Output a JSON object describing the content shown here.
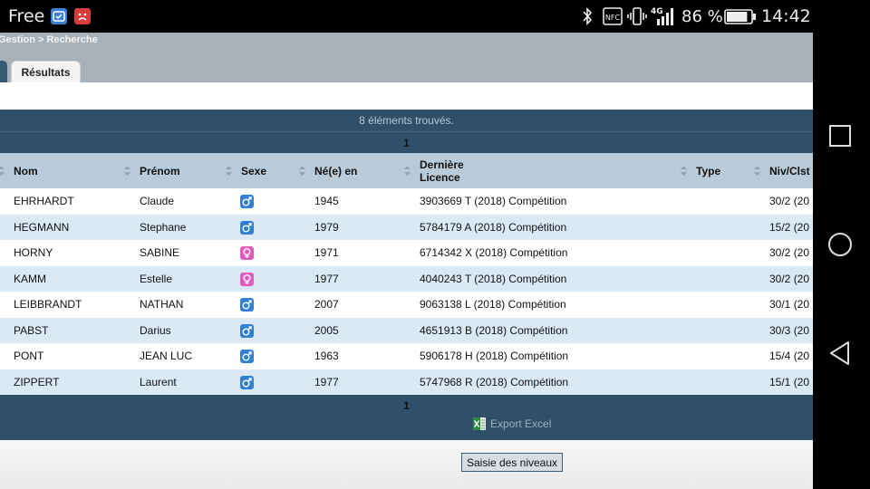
{
  "status_bar": {
    "carrier": "Free",
    "notification_icons": [
      "app-icon",
      "sad-face-icon"
    ],
    "system_icons": [
      "bluetooth-icon",
      "nfc-icon",
      "vibrate-icon",
      "4g-signal-icon",
      "battery-icon"
    ],
    "battery_text": "86 %",
    "battery_level": 0.86,
    "time": "14:42"
  },
  "nav_bar": {
    "buttons": [
      "recents",
      "home",
      "back"
    ]
  },
  "header": {
    "breadcrumb": "Gestion > Recherche",
    "tabs": [
      {
        "label": "",
        "active": false
      },
      {
        "label": "Résultats",
        "active": true
      }
    ]
  },
  "results": {
    "count_text": "8 éléments trouvés.",
    "page_top": "1",
    "page_bottom": "1",
    "export_label": "Export Excel",
    "columns": {
      "nom": "Nom",
      "prenom": "Prénom",
      "sexe": "Sexe",
      "ne": "Né(e) en",
      "licence_line1": "Dernière",
      "licence_line2": "Licence",
      "type": "Type",
      "niv": "Niv/Clst"
    },
    "rows": [
      {
        "nom": "EHRHARDT",
        "prenom": "Claude",
        "sexe": "M",
        "ne": "1945",
        "licence": "3903669 T (2018) Compétition",
        "type": "",
        "niv": "30/2 (20"
      },
      {
        "nom": "HEGMANN",
        "prenom": "Stephane",
        "sexe": "M",
        "ne": "1979",
        "licence": "5784179 A (2018) Compétition",
        "type": "",
        "niv": "15/2 (20"
      },
      {
        "nom": "HORNY",
        "prenom": "SABINE",
        "sexe": "F",
        "ne": "1971",
        "licence": "6714342 X (2018) Compétition",
        "type": "",
        "niv": "30/2 (20"
      },
      {
        "nom": "KAMM",
        "prenom": "Estelle",
        "sexe": "F",
        "ne": "1977",
        "licence": "4040243 T (2018) Compétition",
        "type": "",
        "niv": "30/2 (20"
      },
      {
        "nom": "LEIBBRANDT",
        "prenom": "NATHAN",
        "sexe": "M",
        "ne": "2007",
        "licence": "9063138 L (2018) Compétition",
        "type": "",
        "niv": "30/1 (20"
      },
      {
        "nom": "PABST",
        "prenom": "Darius",
        "sexe": "M",
        "ne": "2005",
        "licence": "4651913 B (2018) Compétition",
        "type": "",
        "niv": "30/3 (20"
      },
      {
        "nom": "PONT",
        "prenom": "JEAN LUC",
        "sexe": "M",
        "ne": "1963",
        "licence": "5906178 H (2018) Compétition",
        "type": "",
        "niv": "15/4 (20"
      },
      {
        "nom": "ZIPPERT",
        "prenom": "Laurent",
        "sexe": "M",
        "ne": "1977",
        "licence": "5747968 R (2018) Compétition",
        "type": "",
        "niv": "15/1 (20"
      }
    ]
  },
  "footer": {
    "button_label": "Saisie des niveaux"
  },
  "colors": {
    "dark_band": "#2f5068",
    "header_row": "#b9cbd8",
    "row_alt": "#dbe9f7",
    "male": "#2f7fd3",
    "female": "#e35bc0"
  }
}
